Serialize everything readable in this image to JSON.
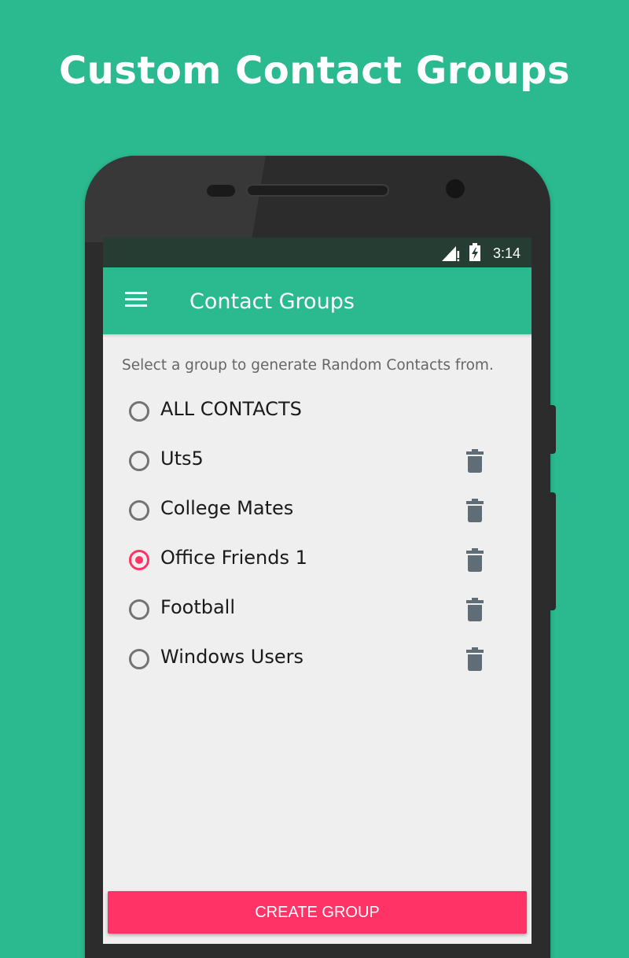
{
  "promo": {
    "headline": "Custom Contact Groups"
  },
  "status_bar": {
    "time": "3:14",
    "signal_icon": "signal-alert-icon",
    "battery_icon": "battery-charging-icon"
  },
  "app_bar": {
    "title": "Contact Groups",
    "menu_icon": "hamburger-menu-icon"
  },
  "main": {
    "instruction": "Select a group to generate Random Contacts from.",
    "groups": [
      {
        "label": "ALL CONTACTS",
        "selected": false,
        "deletable": false
      },
      {
        "label": "Uts5",
        "selected": false,
        "deletable": true
      },
      {
        "label": "College Mates",
        "selected": false,
        "deletable": true
      },
      {
        "label": "Office Friends 1",
        "selected": true,
        "deletable": true
      },
      {
        "label": "Football",
        "selected": false,
        "deletable": true
      },
      {
        "label": "Windows Users",
        "selected": false,
        "deletable": true
      }
    ],
    "delete_icon": "trash-icon"
  },
  "footer": {
    "create_button_label": "CREATE GROUP"
  },
  "colors": {
    "background": "#2bb98f",
    "app_bar": "#2bb98f",
    "status_bar": "#263d33",
    "accent": "#ff3366",
    "delete_icon": "#5f6d76"
  }
}
